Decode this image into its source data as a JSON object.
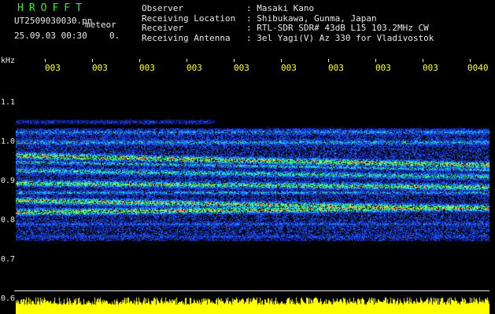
{
  "app": {
    "title": "HROFFT"
  },
  "file": {
    "name": "UT2509030030.pn",
    "datetime": "25.09.03 00:30",
    "count": "0."
  },
  "meteor_label": "meteor",
  "info": {
    "labels": [
      "Observer",
      "Receiving Location",
      "Receiver",
      "Receiving Antenna"
    ],
    "values": [
      ": Masaki Kano",
      ": Shibukawa, Gunma, Japan",
      ": RTL-SDR SDR# 43dB L15 103.2MHz CW",
      ": 3el Yagi(V) Az 330 for Vladivostok"
    ]
  },
  "axis": {
    "unit": "kHz",
    "y_ticks": [
      "1.1",
      "1.0",
      "0.9",
      "0.8",
      "0.7",
      "0.6"
    ],
    "x_ticks": [
      "003",
      "003",
      "003",
      "003",
      "003",
      "003",
      "003",
      "003",
      "003",
      "0040"
    ]
  },
  "colors": {
    "background": "#000000",
    "title": "#39e639",
    "text": "#e8e8e8",
    "time_ticks": "#ffff33",
    "noise_floor": "#ffff00"
  }
}
